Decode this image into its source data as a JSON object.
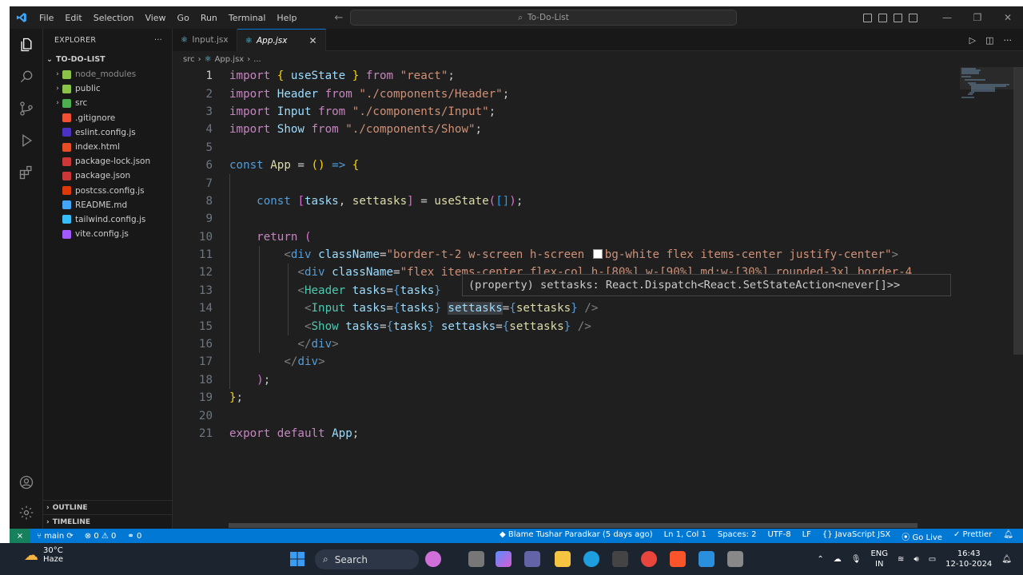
{
  "titlebar": {
    "menu": [
      "File",
      "Edit",
      "Selection",
      "View",
      "Go",
      "Run",
      "Terminal",
      "Help"
    ],
    "search_text": "To-Do-List"
  },
  "sidebar": {
    "title": "EXPLORER",
    "more": "···",
    "root": "TO-DO-LIST",
    "items": [
      {
        "label": "node_modules",
        "type": "folder",
        "icon": "folder-node-icon",
        "color": "#8bc34a",
        "dim": true
      },
      {
        "label": "public",
        "type": "folder",
        "icon": "folder-public-icon",
        "color": "#8bc34a"
      },
      {
        "label": "src",
        "type": "folder",
        "icon": "folder-src-icon",
        "color": "#4caf50"
      },
      {
        "label": ".gitignore",
        "type": "file",
        "icon": "git-icon",
        "color": "#f05033"
      },
      {
        "label": "eslint.config.js",
        "type": "file",
        "icon": "eslint-icon",
        "color": "#4b32c3"
      },
      {
        "label": "index.html",
        "type": "file",
        "icon": "html-icon",
        "color": "#e44d26"
      },
      {
        "label": "package-lock.json",
        "type": "file",
        "icon": "npm-icon",
        "color": "#cb3837"
      },
      {
        "label": "package.json",
        "type": "file",
        "icon": "npm-icon",
        "color": "#cb3837"
      },
      {
        "label": "postcss.config.js",
        "type": "file",
        "icon": "postcss-icon",
        "color": "#dd3a0a"
      },
      {
        "label": "README.md",
        "type": "file",
        "icon": "markdown-icon",
        "color": "#42a5f5"
      },
      {
        "label": "tailwind.config.js",
        "type": "file",
        "icon": "tailwind-icon",
        "color": "#38bdf8"
      },
      {
        "label": "vite.config.js",
        "type": "file",
        "icon": "vite-icon",
        "color": "#a259ff"
      }
    ],
    "outline": "OUTLINE",
    "timeline": "TIMELINE"
  },
  "tabs": [
    {
      "label": "Input.jsx",
      "active": false
    },
    {
      "label": "App.jsx",
      "active": true,
      "close": "✕"
    }
  ],
  "breadcrumb": {
    "folder": "src",
    "file": "App.jsx",
    "rest": "..."
  },
  "code": {
    "line_numbers": [
      "1",
      "2",
      "3",
      "4",
      "5",
      "6",
      "7",
      "8",
      "9",
      "10",
      "11",
      "12",
      "13",
      "14",
      "15",
      "16",
      "17",
      "18",
      "19",
      "20",
      "21"
    ],
    "current_line": "1"
  },
  "hover": "(property) settasks: React.Dispatch<React.SetStateAction<never[]>>",
  "statusbar": {
    "branch": "main",
    "problems": "⊗ 0 ⚠ 0",
    "ports": "0",
    "blame": "Blame Tushar Paradkar (5 days ago)",
    "position": "Ln 1, Col 1",
    "spaces": "Spaces: 2",
    "encoding": "UTF-8",
    "eol": "LF",
    "language": "JavaScript JSX",
    "golive": "Go Live",
    "prettier": "Prettier"
  },
  "taskbar": {
    "temp": "30°C",
    "weather": "Haze",
    "search": "Search",
    "lang1": "ENG",
    "lang2": "IN",
    "time": "16:43",
    "date": "12-10-2024"
  }
}
